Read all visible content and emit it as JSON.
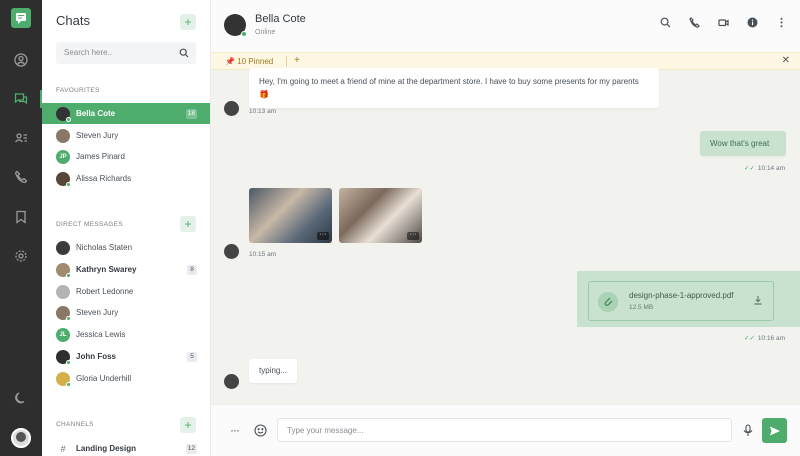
{
  "app": {
    "accent": "#4eac6d"
  },
  "rail": {
    "icons": [
      "chat-logo-icon",
      "user-circle-icon",
      "chat-bubbles-icon",
      "contacts-icon",
      "phone-icon",
      "bookmark-icon",
      "settings-icon",
      "moon-icon"
    ]
  },
  "sidebar": {
    "title": "Chats",
    "search_placeholder": "Search here..",
    "favourites_heading": "FAVOURITES",
    "favourites": [
      {
        "name": "Bella Cote",
        "badge": "18",
        "active": true
      },
      {
        "name": "Steven Jury",
        "badge": ""
      },
      {
        "name": "James Pinard",
        "initials": "JP",
        "badge": ""
      },
      {
        "name": "Alissa Richards",
        "badge": ""
      }
    ],
    "dm_heading": "DIRECT MESSAGES",
    "direct_messages": [
      {
        "name": "Nicholas Staten",
        "badge": ""
      },
      {
        "name": "Kathryn Swarey",
        "badge": "8",
        "bold": true
      },
      {
        "name": "Robert Ledonne",
        "badge": ""
      },
      {
        "name": "Steven Jury",
        "badge": ""
      },
      {
        "name": "Jessica Lewis",
        "initials": "JL",
        "badge": ""
      },
      {
        "name": "John Foss",
        "badge": "5",
        "bold": true
      },
      {
        "name": "Gloria Underhill",
        "badge": ""
      }
    ],
    "channels_heading": "CHANNELS",
    "channels": [
      {
        "name": "Landing Design",
        "badge": "12",
        "bold": true
      }
    ]
  },
  "header": {
    "name": "Bella Cote",
    "status": "Online",
    "actions": [
      "search-icon",
      "phone-icon",
      "video-icon",
      "info-icon",
      "more-vertical-icon"
    ]
  },
  "pinned": {
    "label": "10 Pinned",
    "add": "+",
    "close": "✕"
  },
  "messages": {
    "m1_text": "Hey, I'm going to meet a friend of mine at the department store. I have to buy some presents for my parents 🎁",
    "m1_time": "10:13 am",
    "m2_text": "Wow that's great",
    "m2_time": "10:14 am",
    "m3_time": "10:15 am",
    "m4_file_name": "design-phase-1-approved.pdf",
    "m4_file_size": "12.5 MB",
    "m4_time": "10:16 am",
    "typing": "typing..."
  },
  "composer": {
    "placeholder": "Type your message..."
  }
}
